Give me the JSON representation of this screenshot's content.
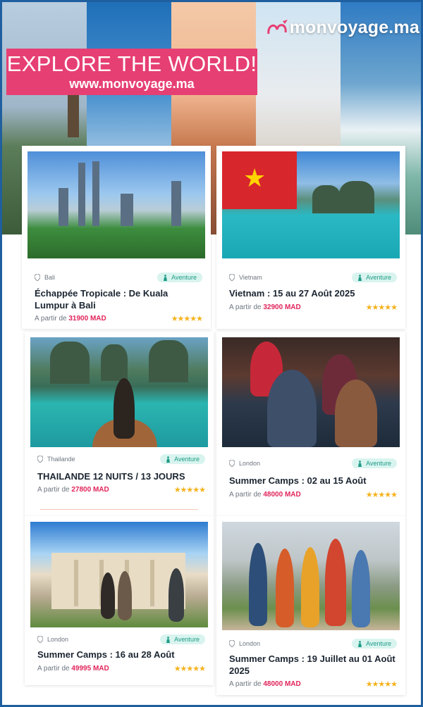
{
  "brand": {
    "name": "monvoyage.ma",
    "logo_icon": "plane-loop-icon"
  },
  "banner": {
    "title": "EXPLORE THE WORLD!",
    "url": "www.monvoyage.ma"
  },
  "colors": {
    "accent_pink": "#e63f73",
    "price_red": "#e1245a",
    "tag_teal": "#1e9b86",
    "tag_bg": "#d9f4ef",
    "star_gold": "#f5b21c",
    "frame_blue": "#1f5f9f"
  },
  "cards": [
    {
      "location": "Bali",
      "tag": "Aventure",
      "title": "Échappée Tropicale : De Kuala Lumpur à Bali",
      "price_prefix": "A partir de",
      "price": "31900 MAD",
      "rating": 5,
      "stars": "★★★★★"
    },
    {
      "location": "Vietnam",
      "tag": "Aventure",
      "title": "Vietnam : 15 au 27 Août 2025",
      "price_prefix": "A partir de",
      "price": "32900 MAD",
      "rating": 5,
      "stars": "★★★★★"
    },
    {
      "location": "Thailande",
      "tag": "Aventure",
      "title": "THAILANDE 12 NUITS / 13 JOURS",
      "price_prefix": "A partir de",
      "price": "27800 MAD",
      "rating": 5,
      "stars": "★★★★★"
    },
    {
      "location": "London",
      "tag": "Aventure",
      "title": "Summer Camps : 02 au 15 Août",
      "price_prefix": "A partir de",
      "price": "48000 MAD",
      "rating": 5,
      "stars": "★★★★★"
    },
    {
      "location": "London",
      "tag": "Aventure",
      "title": "Summer Camps : 16 au 28 Août",
      "price_prefix": "A partir de",
      "price": "49995 MAD",
      "rating": 5,
      "stars": "★★★★★"
    },
    {
      "location": "London",
      "tag": "Aventure",
      "title": "Summer Camps : 19 Juillet au 01 Août 2025",
      "price_prefix": "A partir de",
      "price": "48000 MAD",
      "rating": 5,
      "stars": "★★★★★"
    }
  ],
  "icons": {
    "location": "map-pin-icon",
    "tag": "hiker-icon",
    "rating": "star-icon"
  }
}
